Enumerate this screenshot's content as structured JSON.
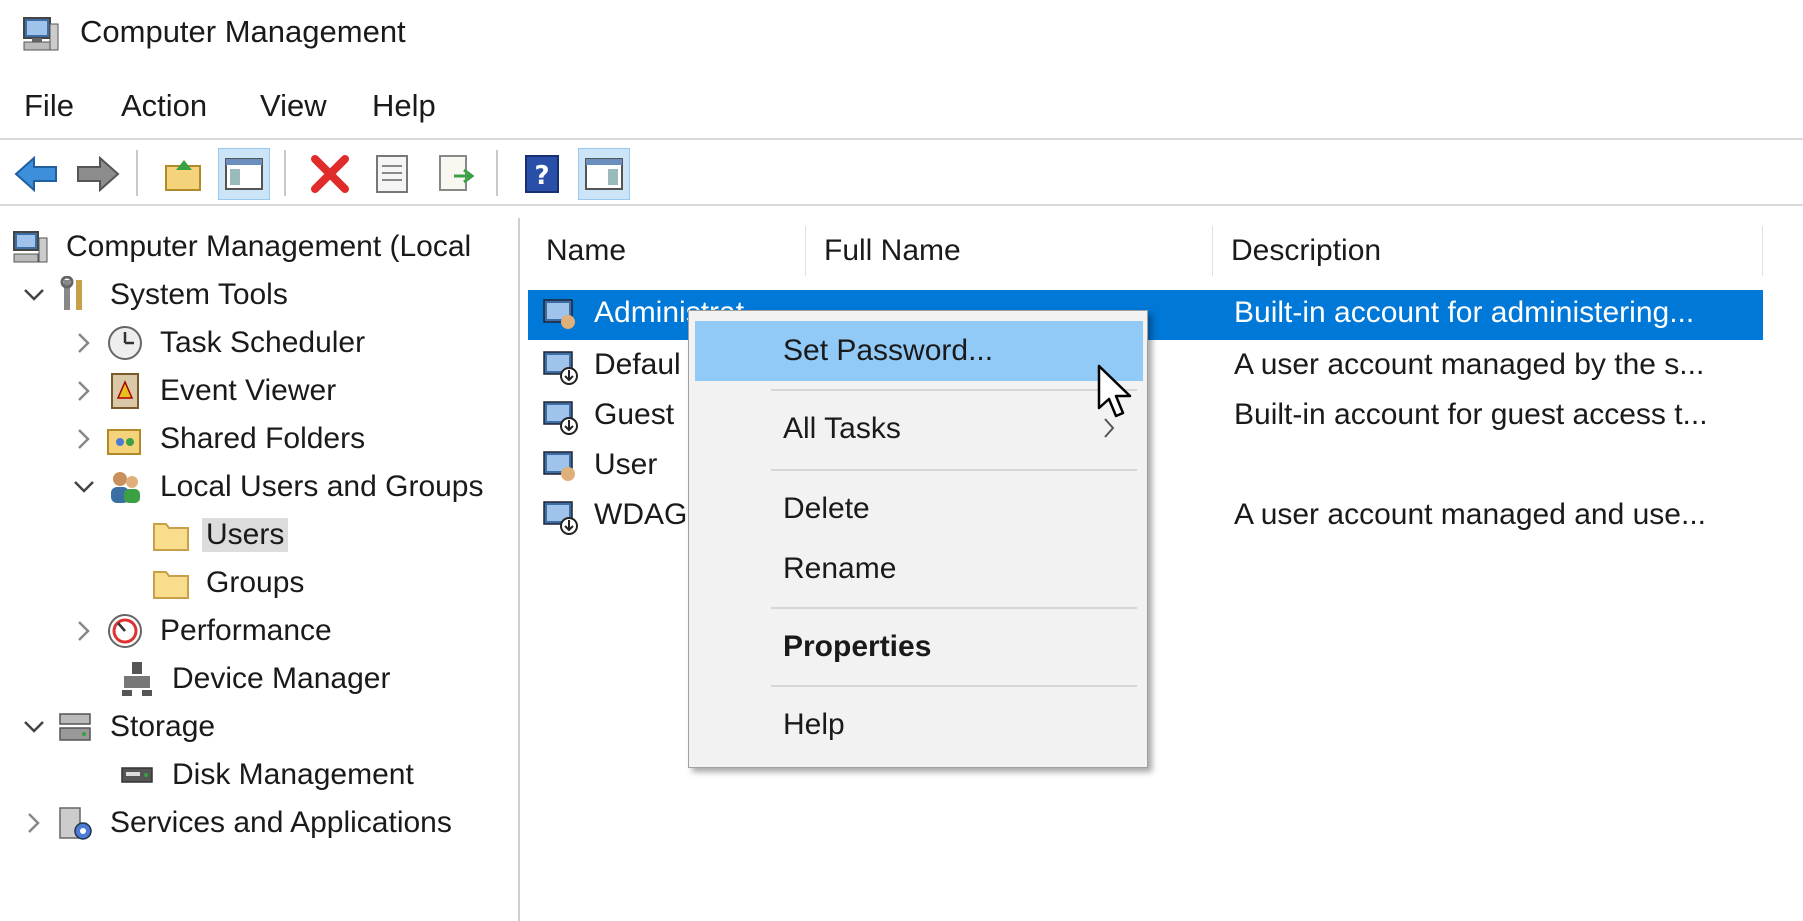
{
  "window": {
    "title": "Computer Management"
  },
  "menubar": {
    "items": [
      "File",
      "Action",
      "View",
      "Help"
    ]
  },
  "toolbar": {
    "buttons": [
      "back-arrow-icon",
      "forward-arrow-icon",
      "up-folder-icon",
      "show-hide-console-tree-icon",
      "delete-icon",
      "properties-icon",
      "export-list-icon",
      "help-icon",
      "show-hide-action-pane-icon"
    ]
  },
  "tree": {
    "root": "Computer Management (Local",
    "system_tools": "System Tools",
    "task_scheduler": "Task Scheduler",
    "event_viewer": "Event Viewer",
    "shared_folders": "Shared Folders",
    "local_users_groups": "Local Users and Groups",
    "users": "Users",
    "groups": "Groups",
    "performance": "Performance",
    "device_manager": "Device Manager",
    "storage": "Storage",
    "disk_management": "Disk Management",
    "services_apps": "Services and Applications"
  },
  "list": {
    "columns": [
      "Name",
      "Full Name",
      "Description"
    ],
    "rows": [
      {
        "name": "Administrat",
        "full_name": "",
        "description": "Built-in account for administering..."
      },
      {
        "name": "Defaul",
        "full_name": "",
        "description": "A user account managed by the s..."
      },
      {
        "name": "Guest",
        "full_name": "",
        "description": "Built-in account for guest access t..."
      },
      {
        "name": "User",
        "full_name": "",
        "description": ""
      },
      {
        "name": "WDAG",
        "full_name": "",
        "description": "A user account managed and use..."
      }
    ]
  },
  "context_menu": {
    "set_password": "Set Password...",
    "all_tasks": "All Tasks",
    "delete": "Delete",
    "rename": "Rename",
    "properties": "Properties",
    "help": "Help"
  },
  "colors": {
    "selection": "#0078d7",
    "menu_highlight": "#91c9f7",
    "menu_bg": "#f2f2f2"
  }
}
